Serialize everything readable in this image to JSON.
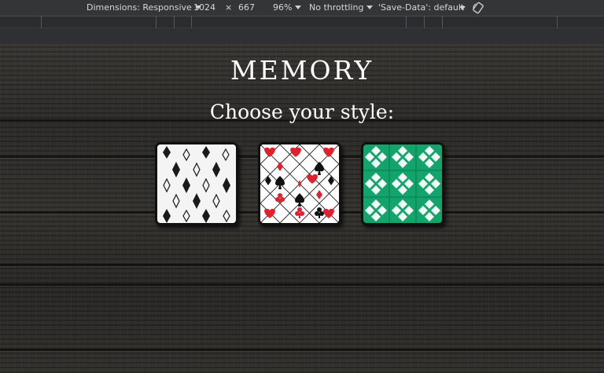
{
  "devtools": {
    "dimensions_label": "Dimensions: Responsive",
    "width": "1024",
    "times": "×",
    "height": "667",
    "zoom": "96%",
    "throttling": "No throttling",
    "save_data": "'Save-Data': default",
    "rotate_icon": "rotate-icon"
  },
  "page": {
    "title": "MEMORY",
    "subtitle": "Choose your style:"
  },
  "styles": [
    {
      "name": "diamonds-pattern"
    },
    {
      "name": "card-suits-pattern"
    },
    {
      "name": "green-argyle-pattern"
    }
  ],
  "colors": {
    "suit_red": "#e0202e",
    "green": "#12a46a",
    "wood": "#312f2d"
  }
}
